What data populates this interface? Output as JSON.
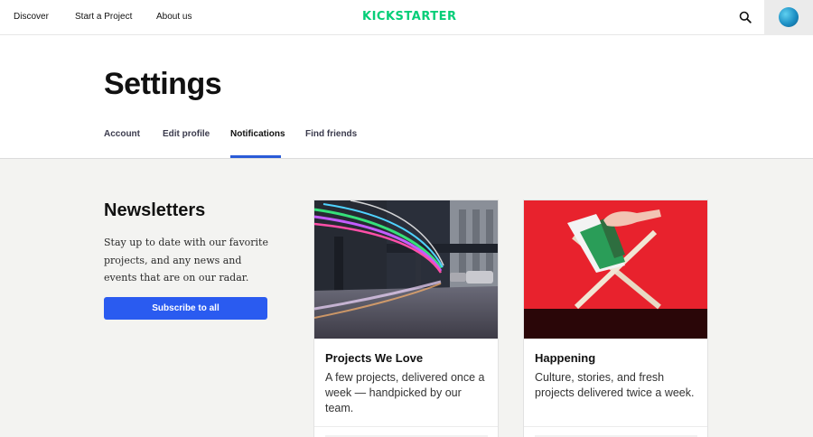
{
  "nav": {
    "discover": "Discover",
    "start_project": "Start a Project",
    "about": "About us",
    "logo_part1": "KICK",
    "logo_part2": "STARTER",
    "search_icon": "search-icon",
    "avatar_icon": "globe-avatar"
  },
  "settings": {
    "title": "Settings",
    "tabs": [
      {
        "label": "Account",
        "active": false
      },
      {
        "label": "Edit profile",
        "active": false
      },
      {
        "label": "Notifications",
        "active": true
      },
      {
        "label": "Find friends",
        "active": false
      }
    ]
  },
  "newsletters": {
    "heading": "Newsletters",
    "description": "Stay up to date with our favorite projects, and any news and events that are on our radar.",
    "subscribe_label": "Subscribe to all"
  },
  "cards": [
    {
      "title": "Projects We Love",
      "description": "A few projects, delivered once a week — handpicked by our team."
    },
    {
      "title": "Happening",
      "description": "Culture, stories, and fresh projects delivered twice a week."
    }
  ],
  "colors": {
    "accent": "#2a5bf0",
    "brand_green": "#05ce78"
  }
}
